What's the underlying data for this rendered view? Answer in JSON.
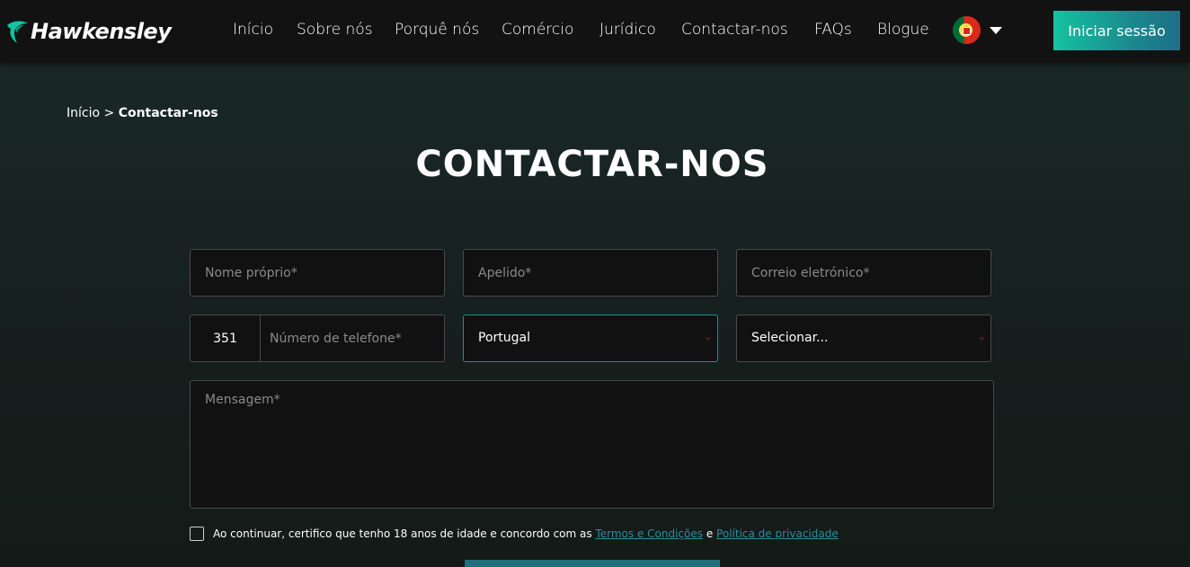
{
  "header": {
    "brand": "Hawkensley",
    "nav": [
      {
        "label": "Início"
      },
      {
        "label": "Sobre nós"
      },
      {
        "label": "Porquê nós"
      },
      {
        "label": "Comércio"
      },
      {
        "label": "Jurídico"
      },
      {
        "label": "Contactar-nos"
      },
      {
        "label": "FAQs"
      },
      {
        "label": "Blogue"
      }
    ],
    "language_icon": "portugal-flag-icon",
    "login_label": "Iniciar sessão"
  },
  "breadcrumb": {
    "home": "Início",
    "separator": ">",
    "current": "Contactar-nos"
  },
  "title": "CONTACTAR-NOS",
  "form": {
    "first_name_placeholder": "Nome próprio*",
    "last_name_placeholder": "Apelido*",
    "email_placeholder": "Correio eletrónico*",
    "dial_code": "351",
    "phone_placeholder": "Número de telefone*",
    "country_value": "Portugal",
    "select_value": "Selecionar...",
    "message_placeholder": "Mensagem*",
    "consent_text": "Ao continuar, certifico que tenho 18 anos de idade e concordo com as",
    "terms_link": "Termos e Condições",
    "and": "e",
    "privacy_link": "Política de privacidade"
  },
  "colors": {
    "accent": "#14c3a0",
    "link": "#2a8f9b",
    "background": "#1a2a27",
    "header": "#121212"
  }
}
